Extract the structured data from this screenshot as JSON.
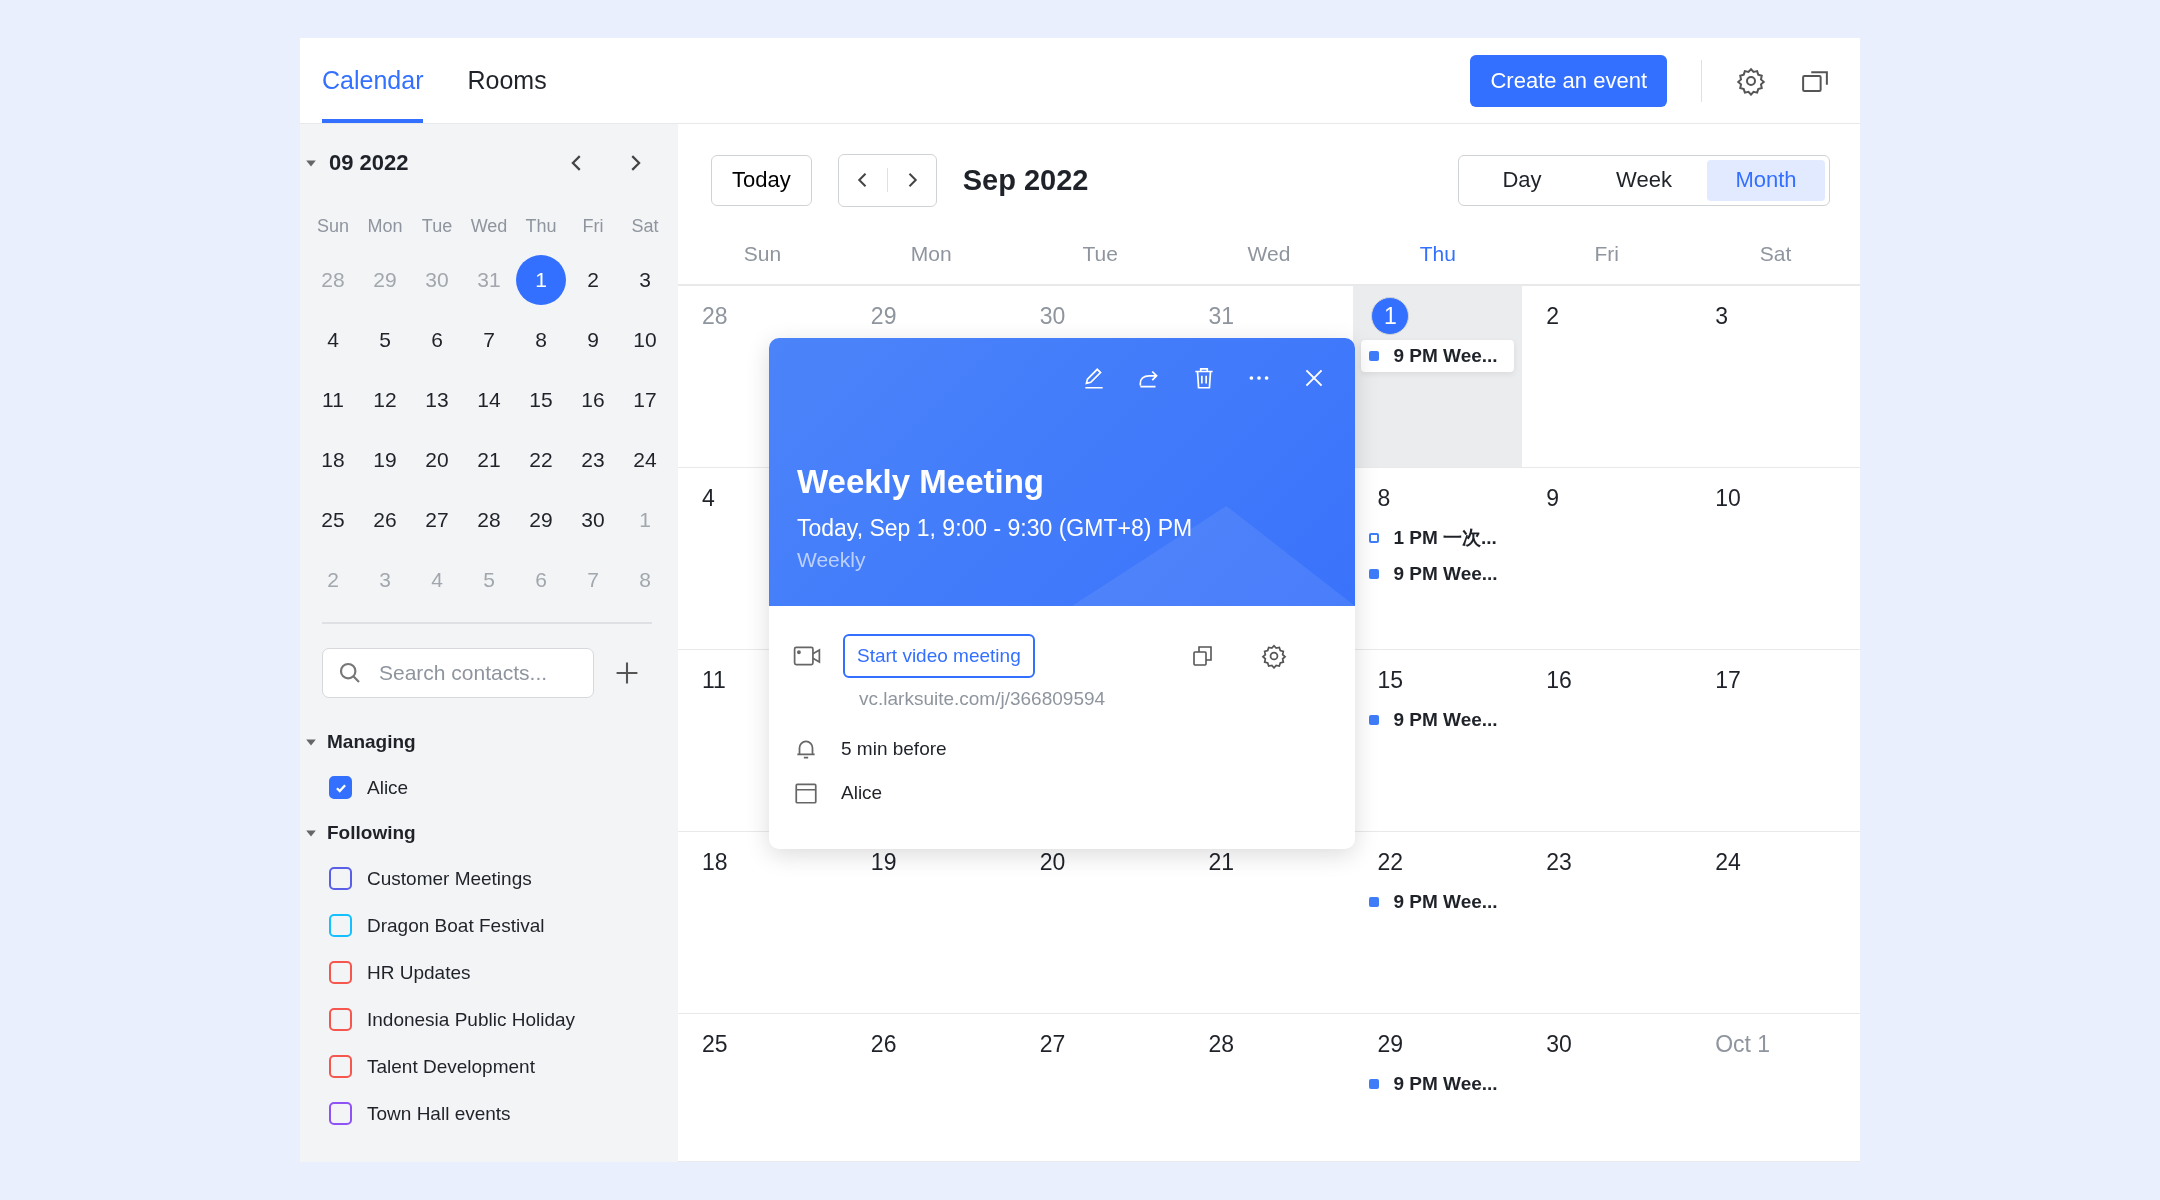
{
  "tabs": [
    {
      "label": "Calendar",
      "selected": true
    },
    {
      "label": "Rooms",
      "selected": false
    }
  ],
  "header": {
    "create_button": "Create an event"
  },
  "mini_calendar": {
    "title": "09 2022",
    "expanded": true,
    "weekdays": [
      "Sun",
      "Mon",
      "Tue",
      "Wed",
      "Thu",
      "Fri",
      "Sat"
    ],
    "days": [
      {
        "day": "28",
        "muted": true,
        "selected": false
      },
      {
        "day": "29",
        "muted": true,
        "selected": false
      },
      {
        "day": "30",
        "muted": true,
        "selected": false
      },
      {
        "day": "31",
        "muted": true,
        "selected": false
      },
      {
        "day": "1",
        "muted": false,
        "selected": true
      },
      {
        "day": "2",
        "muted": false,
        "selected": false
      },
      {
        "day": "3",
        "muted": false,
        "selected": false
      },
      {
        "day": "4",
        "muted": false,
        "selected": false
      },
      {
        "day": "5",
        "muted": false,
        "selected": false
      },
      {
        "day": "6",
        "muted": false,
        "selected": false
      },
      {
        "day": "7",
        "muted": false,
        "selected": false
      },
      {
        "day": "8",
        "muted": false,
        "selected": false
      },
      {
        "day": "9",
        "muted": false,
        "selected": false
      },
      {
        "day": "10",
        "muted": false,
        "selected": false
      },
      {
        "day": "11",
        "muted": false,
        "selected": false
      },
      {
        "day": "12",
        "muted": false,
        "selected": false
      },
      {
        "day": "13",
        "muted": false,
        "selected": false
      },
      {
        "day": "14",
        "muted": false,
        "selected": false
      },
      {
        "day": "15",
        "muted": false,
        "selected": false
      },
      {
        "day": "16",
        "muted": false,
        "selected": false
      },
      {
        "day": "17",
        "muted": false,
        "selected": false
      },
      {
        "day": "18",
        "muted": false,
        "selected": false
      },
      {
        "day": "19",
        "muted": false,
        "selected": false
      },
      {
        "day": "20",
        "muted": false,
        "selected": false
      },
      {
        "day": "21",
        "muted": false,
        "selected": false
      },
      {
        "day": "22",
        "muted": false,
        "selected": false
      },
      {
        "day": "23",
        "muted": false,
        "selected": false
      },
      {
        "day": "24",
        "muted": false,
        "selected": false
      },
      {
        "day": "25",
        "muted": false,
        "selected": false
      },
      {
        "day": "26",
        "muted": false,
        "selected": false
      },
      {
        "day": "27",
        "muted": false,
        "selected": false
      },
      {
        "day": "28",
        "muted": false,
        "selected": false
      },
      {
        "day": "29",
        "muted": false,
        "selected": false
      },
      {
        "day": "30",
        "muted": false,
        "selected": false
      },
      {
        "day": "1",
        "muted": true,
        "selected": false
      },
      {
        "day": "2",
        "muted": true,
        "selected": false
      },
      {
        "day": "3",
        "muted": true,
        "selected": false
      },
      {
        "day": "4",
        "muted": true,
        "selected": false
      },
      {
        "day": "5",
        "muted": true,
        "selected": false
      },
      {
        "day": "6",
        "muted": true,
        "selected": false
      },
      {
        "day": "7",
        "muted": true,
        "selected": false
      },
      {
        "day": "8",
        "muted": true,
        "selected": false
      }
    ]
  },
  "search": {
    "placeholder": "Search contacts..."
  },
  "groups": [
    {
      "title": "Managing",
      "expanded": true,
      "items": [
        {
          "label": "Alice",
          "checked": true,
          "color": "#3370ff"
        }
      ]
    },
    {
      "title": "Following",
      "expanded": true,
      "items": [
        {
          "label": "Customer Meetings",
          "checked": false,
          "color": "#5b5fe8"
        },
        {
          "label": "Dragon Boat Festival",
          "checked": false,
          "color": "#14c0ff"
        },
        {
          "label": "HR Updates",
          "checked": false,
          "color": "#f5574f"
        },
        {
          "label": "Indonesia Public Holiday",
          "checked": false,
          "color": "#f5574f"
        },
        {
          "label": "Talent Development",
          "checked": false,
          "color": "#f5574f"
        },
        {
          "label": "Town Hall events",
          "checked": false,
          "color": "#8f53f5"
        }
      ]
    }
  ],
  "toolbar": {
    "today_button": "Today",
    "period": "Sep 2022",
    "views": [
      {
        "label": "Day",
        "selected": false
      },
      {
        "label": "Week",
        "selected": false
      },
      {
        "label": "Month",
        "selected": true
      }
    ]
  },
  "weekdays": [
    {
      "label": "Sun",
      "selected": false
    },
    {
      "label": "Mon",
      "selected": false
    },
    {
      "label": "Tue",
      "selected": false
    },
    {
      "label": "Wed",
      "selected": false
    },
    {
      "label": "Thu",
      "selected": true
    },
    {
      "label": "Fri",
      "selected": false
    },
    {
      "label": "Sat",
      "selected": false
    }
  ],
  "month_cells": [
    {
      "day": "28",
      "muted": true,
      "today": false,
      "selected": false
    },
    {
      "day": "29",
      "muted": true,
      "today": false,
      "selected": false
    },
    {
      "day": "30",
      "muted": true,
      "today": false,
      "selected": false
    },
    {
      "day": "31",
      "muted": true,
      "today": false,
      "selected": false
    },
    {
      "day": "1",
      "muted": false,
      "today": true,
      "selected": true,
      "events": [
        {
          "text": "9 PM Wee...",
          "kind": "filled",
          "selected": true
        }
      ]
    },
    {
      "day": "2",
      "muted": false,
      "today": false,
      "selected": false
    },
    {
      "day": "3",
      "muted": false,
      "today": false,
      "selected": false
    },
    {
      "day": "4",
      "muted": false,
      "today": false,
      "selected": false
    },
    {},
    {},
    {},
    {
      "day": "8",
      "muted": false,
      "today": false,
      "selected": false,
      "events": [
        {
          "text": "1 PM 一次...",
          "kind": "outline",
          "selected": false
        },
        {
          "text": "9 PM Wee...",
          "kind": "filled",
          "selected": false
        }
      ]
    },
    {
      "day": "9",
      "muted": false,
      "today": false,
      "selected": false
    },
    {
      "day": "10",
      "muted": false,
      "today": false,
      "selected": false
    },
    {
      "day": "11",
      "muted": false,
      "today": false,
      "selected": false
    },
    {},
    {},
    {},
    {
      "day": "15",
      "muted": false,
      "today": false,
      "selected": false,
      "events": [
        {
          "text": "9 PM Wee...",
          "kind": "filled",
          "selected": false
        }
      ]
    },
    {
      "day": "16",
      "muted": false,
      "today": false,
      "selected": false
    },
    {
      "day": "17",
      "muted": false,
      "today": false,
      "selected": false
    },
    {
      "day": "18",
      "muted": false,
      "today": false,
      "selected": false
    },
    {
      "day": "19",
      "muted": false,
      "today": false,
      "selected": false
    },
    {
      "day": "20",
      "muted": false,
      "today": false,
      "selected": false
    },
    {
      "day": "21",
      "muted": false,
      "today": false,
      "selected": false
    },
    {
      "day": "22",
      "muted": false,
      "today": false,
      "selected": false,
      "events": [
        {
          "text": "9 PM Wee...",
          "kind": "filled",
          "selected": false
        }
      ]
    },
    {
      "day": "23",
      "muted": false,
      "today": false,
      "selected": false
    },
    {
      "day": "24",
      "muted": false,
      "today": false,
      "selected": false
    },
    {
      "day": "25",
      "muted": false,
      "today": false,
      "selected": false
    },
    {
      "day": "26",
      "muted": false,
      "today": false,
      "selected": false
    },
    {
      "day": "27",
      "muted": false,
      "today": false,
      "selected": false
    },
    {
      "day": "28",
      "muted": false,
      "today": false,
      "selected": false
    },
    {
      "day": "29",
      "muted": false,
      "today": false,
      "selected": false,
      "events": [
        {
          "text": "9 PM Wee...",
          "kind": "filled",
          "selected": false
        }
      ]
    },
    {
      "day": "30",
      "muted": false,
      "today": false,
      "selected": false
    },
    {
      "day": "Oct 1",
      "muted": true,
      "today": false,
      "selected": false
    }
  ],
  "popup": {
    "title": "Weekly Meeting",
    "time": "Today, Sep 1, 9:00 - 9:30 (GMT+8) PM",
    "repeat": "Weekly",
    "video_button": "Start video meeting",
    "link": "vc.larksuite.com/j/366809594",
    "reminder": "5 min before",
    "calendar": "Alice"
  }
}
